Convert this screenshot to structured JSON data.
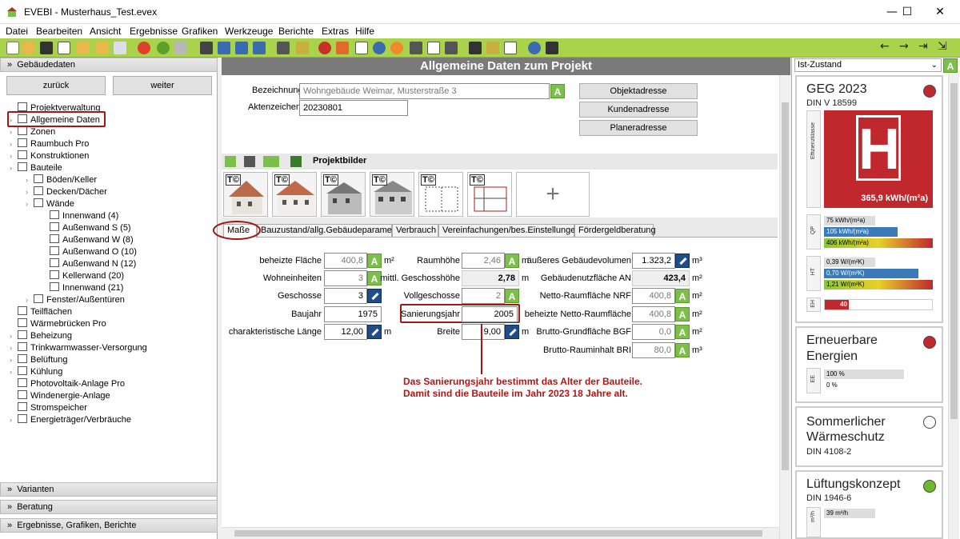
{
  "window": {
    "app_name": "EVEBI",
    "title": "EVEBI  - Musterhaus_Test.evex",
    "minimize": "—",
    "maximize": "☐",
    "close": "✕"
  },
  "menu": [
    "Datei",
    "Bearbeiten",
    "Ansicht",
    "Ergebnisse",
    "Grafiken",
    "Werkzeuge",
    "Berichte",
    "Extras",
    "Hilfe"
  ],
  "left": {
    "header": "Gebäudedaten",
    "back": "zurück",
    "next": "weiter",
    "tree": [
      {
        "label": "Projektverwaltung",
        "level": 0,
        "exp": false
      },
      {
        "label": "Allgemeine Daten",
        "level": 0,
        "exp": true
      },
      {
        "label": "Zonen",
        "level": 0,
        "exp": true
      },
      {
        "label": "Raumbuch Pro",
        "level": 0,
        "exp": true
      },
      {
        "label": "Konstruktionen",
        "level": 0,
        "exp": true
      },
      {
        "label": "Bauteile",
        "level": 0,
        "exp": true
      },
      {
        "label": "Böden/Keller",
        "level": 1,
        "exp": true
      },
      {
        "label": "Decken/Dächer",
        "level": 1,
        "exp": true
      },
      {
        "label": "Wände",
        "level": 1,
        "exp": true
      },
      {
        "label": "Innenwand (4)",
        "level": 2,
        "exp": false
      },
      {
        "label": "Außenwand S (5)",
        "level": 2,
        "exp": false
      },
      {
        "label": "Außenwand W (8)",
        "level": 2,
        "exp": false
      },
      {
        "label": "Außenwand O (10)",
        "level": 2,
        "exp": false
      },
      {
        "label": "Außenwand N (12)",
        "level": 2,
        "exp": false
      },
      {
        "label": "Kellerwand (20)",
        "level": 2,
        "exp": false
      },
      {
        "label": "Innenwand (21)",
        "level": 2,
        "exp": false
      },
      {
        "label": "Fenster/Außentüren",
        "level": 1,
        "exp": true
      },
      {
        "label": "Teilflächen",
        "level": 0,
        "exp": false
      },
      {
        "label": "Wärmebrücken Pro",
        "level": 0,
        "exp": false
      },
      {
        "label": "Beheizung",
        "level": 0,
        "exp": true
      },
      {
        "label": "Trinkwarmwasser-Versorgung",
        "level": 0,
        "exp": true
      },
      {
        "label": "Belüftung",
        "level": 0,
        "exp": true
      },
      {
        "label": "Kühlung",
        "level": 0,
        "exp": true
      },
      {
        "label": "Photovoltaik-Anlage Pro",
        "level": 0,
        "exp": false
      },
      {
        "label": "Windenergie-Anlage",
        "level": 0,
        "exp": false
      },
      {
        "label": "Stromspeicher",
        "level": 0,
        "exp": false
      },
      {
        "label": "Energieträger/Verbräuche",
        "level": 0,
        "exp": true
      }
    ],
    "sections": [
      "Varianten",
      "Beratung",
      "Ergebnisse, Grafiken, Berichte"
    ]
  },
  "center": {
    "title": "Allgemeine Daten zum Projekt",
    "bezeichnung_label": "Bezeichnung",
    "bezeichnung_value": "Wohngebäude Weimar, Musterstraße 3",
    "aktenzeichen_label": "Aktenzeichen",
    "aktenzeichen_value": "20230801",
    "btn_objekt": "Objektadresse",
    "btn_kunden": "Kundenadresse",
    "btn_planer": "Planeradresse",
    "projektbilder": "Projektbilder",
    "tc": "T©",
    "add": "+",
    "tabs": [
      "Maße",
      "Bauzustand/allg.Gebäudeparameter",
      "Verbrauch",
      "Vereinfachungen/bes.Einstellungen",
      "Fördergeldberatung"
    ],
    "fields": {
      "beheizte_flaeche": {
        "label": "beheizte Fläche",
        "value": "400,8",
        "unit": "m²"
      },
      "wohneinheiten": {
        "label": "Wohneinheiten",
        "value": "3"
      },
      "geschosse": {
        "label": "Geschosse",
        "value": "3"
      },
      "baujahr": {
        "label": "Baujahr",
        "value": "1975"
      },
      "char_laenge": {
        "label": "charakteristische Länge",
        "value": "12,00",
        "unit": "m"
      },
      "raumhoehe": {
        "label": "Raumhöhe",
        "value": "2,46",
        "unit": "m"
      },
      "geschosshoehe": {
        "label": "mittl. Geschosshöhe",
        "value": "2,78",
        "unit": "m"
      },
      "vollgeschosse": {
        "label": "Vollgeschosse",
        "value": "2"
      },
      "sanierungsjahr": {
        "label": "Sanierungsjahr",
        "value": "2005"
      },
      "breite": {
        "label": "Breite",
        "value": "9,00",
        "unit": "m"
      },
      "volumen": {
        "label": "äußeres Gebäudevolumen",
        "value": "1.323,2",
        "unit": "m³"
      },
      "an": {
        "label": "Gebäudenutzfläche AN",
        "value": "423,4",
        "unit": "m²"
      },
      "nrf": {
        "label": "Netto-Raumfläche NRF",
        "value": "400,8",
        "unit": "m²"
      },
      "bnrf": {
        "label": "beheizte Netto-Raumfläche",
        "value": "400,8",
        "unit": "m²"
      },
      "bgf": {
        "label": "Brutto-Grundfläche BGF",
        "value": "0,0",
        "unit": "m²"
      },
      "bri": {
        "label": "Brutto-Rauminhalt BRI",
        "value": "80,0",
        "unit": "m³"
      }
    },
    "a": "A",
    "note_line1": "Das Sanierungsjahr bestimmt das Alter der Bauteile.",
    "note_line2": "Damit sind die Bauteile im Jahr 2023 18 Jahre alt."
  },
  "right": {
    "dropdown": "Ist-Zustand",
    "a": "A",
    "geg": {
      "title": "GEG 2023",
      "subtitle": "DIN V 18599",
      "klasse": "H",
      "klasse_label": "Effizienzklasse",
      "value": "365,9 kWh/(m²a)",
      "qp_label": "QP",
      "qp": [
        "75 kWh/(m²a)",
        "105 kWh/(m²a)",
        "406 kWh/(m²a)"
      ],
      "ht_label": "HT",
      "ht": [
        "0,39 W/(m²K)",
        "0,70 W/(m²K)",
        "1,21 W/(m²K)"
      ],
      "eh_label": "EH",
      "eh": "40",
      "status_color": "#c0282d"
    },
    "ee": {
      "title1": "Erneuerbare",
      "title2": "Energien",
      "label": "EE",
      "values": [
        "100 %",
        "0 %"
      ],
      "status_color": "#c0282d"
    },
    "sw": {
      "title1": "Sommerlicher",
      "title2": "Wärmeschutz",
      "subtitle": "DIN 4108-2",
      "status_color": "#ffffff"
    },
    "lk": {
      "title": "Lüftungskonzept",
      "subtitle": "DIN 1946-6",
      "label": "m³/h",
      "value": "39 m³/h",
      "status_color": "#6cb82f"
    }
  }
}
